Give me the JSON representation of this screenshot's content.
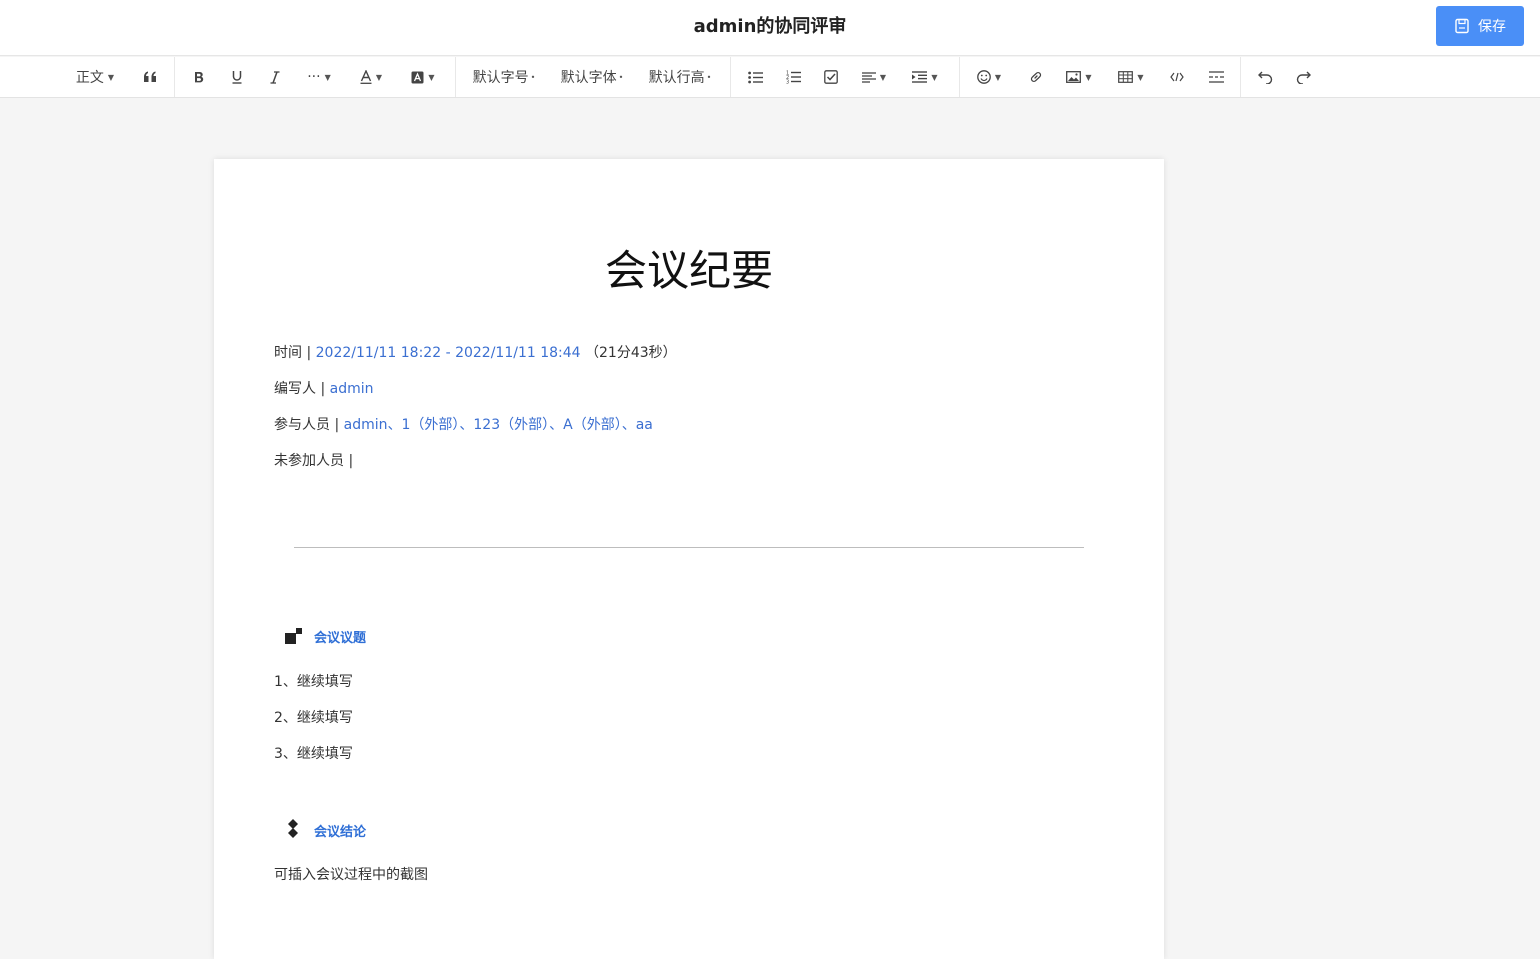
{
  "header": {
    "title": "admin的协同评审",
    "save_label": "保存"
  },
  "toolbar": {
    "paragraph_style": "正文",
    "font_size": "默认字号",
    "font_family": "默认字体",
    "line_height": "默认行高",
    "more_label": "···"
  },
  "document": {
    "title": "会议纪要",
    "time_label": "时间 | ",
    "time_value": "2022/11/11 18:22 - 2022/11/11 18:44",
    "duration": "（21分43秒）",
    "author_label": "编写人 | ",
    "author_value": "admin",
    "participants_label": "参与人员 | ",
    "participants_value": "admin、1（外部）、123（外部）、A（外部）、aa",
    "absent_label": "未参加人员 | ",
    "agenda": {
      "heading": "会议议题",
      "items": [
        "1、继续填写",
        "2、继续填写",
        "3、继续填写"
      ]
    },
    "conclusion": {
      "heading": "会议结论",
      "text": "可插入会议过程中的截图"
    }
  }
}
